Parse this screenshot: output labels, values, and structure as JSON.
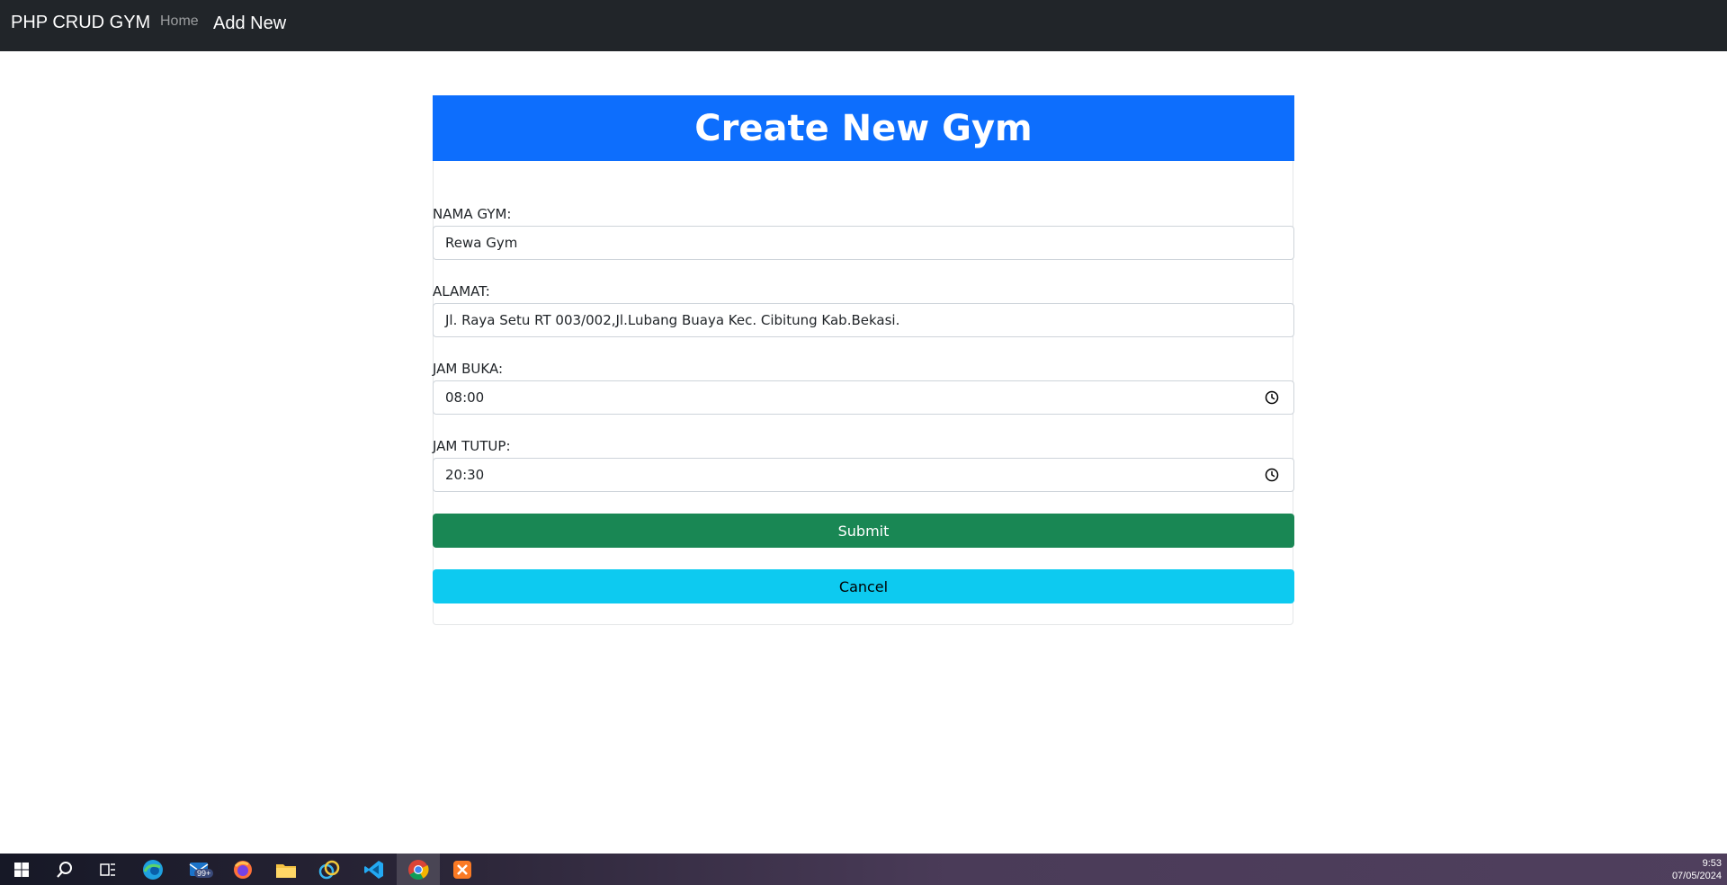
{
  "navbar": {
    "brand": "PHP CRUD GYM",
    "home": "Home",
    "add_new": "Add New"
  },
  "form": {
    "title": "Create New Gym",
    "fields": [
      {
        "label": "NAMA GYM:",
        "value": "Rewa Gym"
      },
      {
        "label": "ALAMAT:",
        "value": "Jl. Raya Setu RT 003/002,Jl.Lubang Buaya Kec. Cibitung Kab.Bekasi."
      },
      {
        "label": "JAM BUKA:",
        "value": "08:00"
      },
      {
        "label": "JAM TUTUP:",
        "value": "20:30"
      }
    ],
    "submit_label": "Submit",
    "cancel_label": "Cancel"
  },
  "taskbar": {
    "mail_badge": "99+",
    "time": "9:53",
    "date": "07/05/2024",
    "icons": [
      "windows-start-icon",
      "search-icon",
      "task-view-icon",
      "edge-icon",
      "mail-icon",
      "firefox-icon",
      "file-explorer-icon",
      "app-icon",
      "vscode-icon",
      "chrome-icon",
      "xampp-icon"
    ]
  },
  "colors": {
    "navbar": "#212529",
    "header": "#0d6efd",
    "submit": "#198754",
    "cancel": "#0dcaf0"
  }
}
